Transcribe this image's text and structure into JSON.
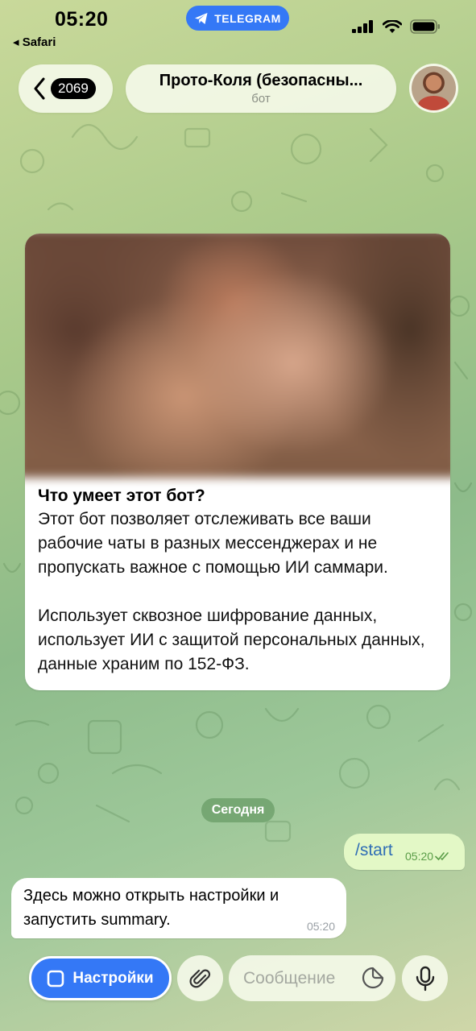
{
  "status_bar": {
    "time": "05:20",
    "back_app": "◂ Safari",
    "pill_label": "TELEGRAM"
  },
  "header": {
    "unread_count": "2069",
    "title": "Прото-Коля (безопасны...",
    "subtitle": "бот"
  },
  "info_card": {
    "title": "Что умеет этот бот?",
    "text": "Этот бот позволяет отслеживать все ваши рабочие чаты в разных мессенджерах и не пропускать важное с помощью ИИ саммари.\n\nИспользует сквозное шифрование данных, использует ИИ с защитой персональных данных, данные храним по 152-ФЗ."
  },
  "date_separator": "Сегодня",
  "messages": [
    {
      "direction": "out",
      "text": "/start",
      "time": "05:20",
      "status": "read"
    },
    {
      "direction": "in",
      "text": "Здесь можно открыть настройки и\nзапустить summary.",
      "time": "05:20"
    }
  ],
  "input_bar": {
    "menu_label": "Настройки",
    "placeholder": "Сообщение"
  },
  "colors": {
    "accent": "#3478f6",
    "outgoing_bubble": "#e3f8c6",
    "read_check": "#5a9d47"
  }
}
